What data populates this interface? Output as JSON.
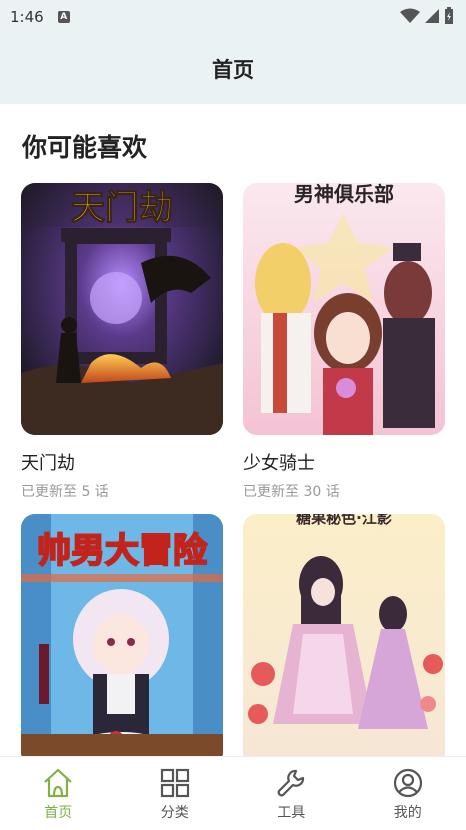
{
  "status_bar": {
    "time": "1:46",
    "notification_glyph": "A"
  },
  "app_bar": {
    "title": "首页"
  },
  "section": {
    "title": "你可能喜欢"
  },
  "cards": [
    {
      "cover_title": "天门劫",
      "title": "天门劫",
      "subtitle": "已更新至 5 话"
    },
    {
      "cover_title": "男神俱乐部",
      "title": "少女骑士",
      "subtitle": "已更新至 30 话"
    },
    {
      "cover_title": "帅男大冒险",
      "title": "",
      "subtitle": ""
    },
    {
      "cover_title": "糖果秘色·江影",
      "title": "",
      "subtitle": ""
    }
  ],
  "bottom_nav": {
    "items": [
      {
        "label": "首页",
        "icon": "home-icon",
        "active": true
      },
      {
        "label": "分类",
        "icon": "grid-icon",
        "active": false
      },
      {
        "label": "工具",
        "icon": "wrench-icon",
        "active": false
      },
      {
        "label": "我的",
        "icon": "profile-icon",
        "active": false
      }
    ]
  },
  "colors": {
    "accent": "#7cb342",
    "header_bg": "#eaf2f3"
  }
}
